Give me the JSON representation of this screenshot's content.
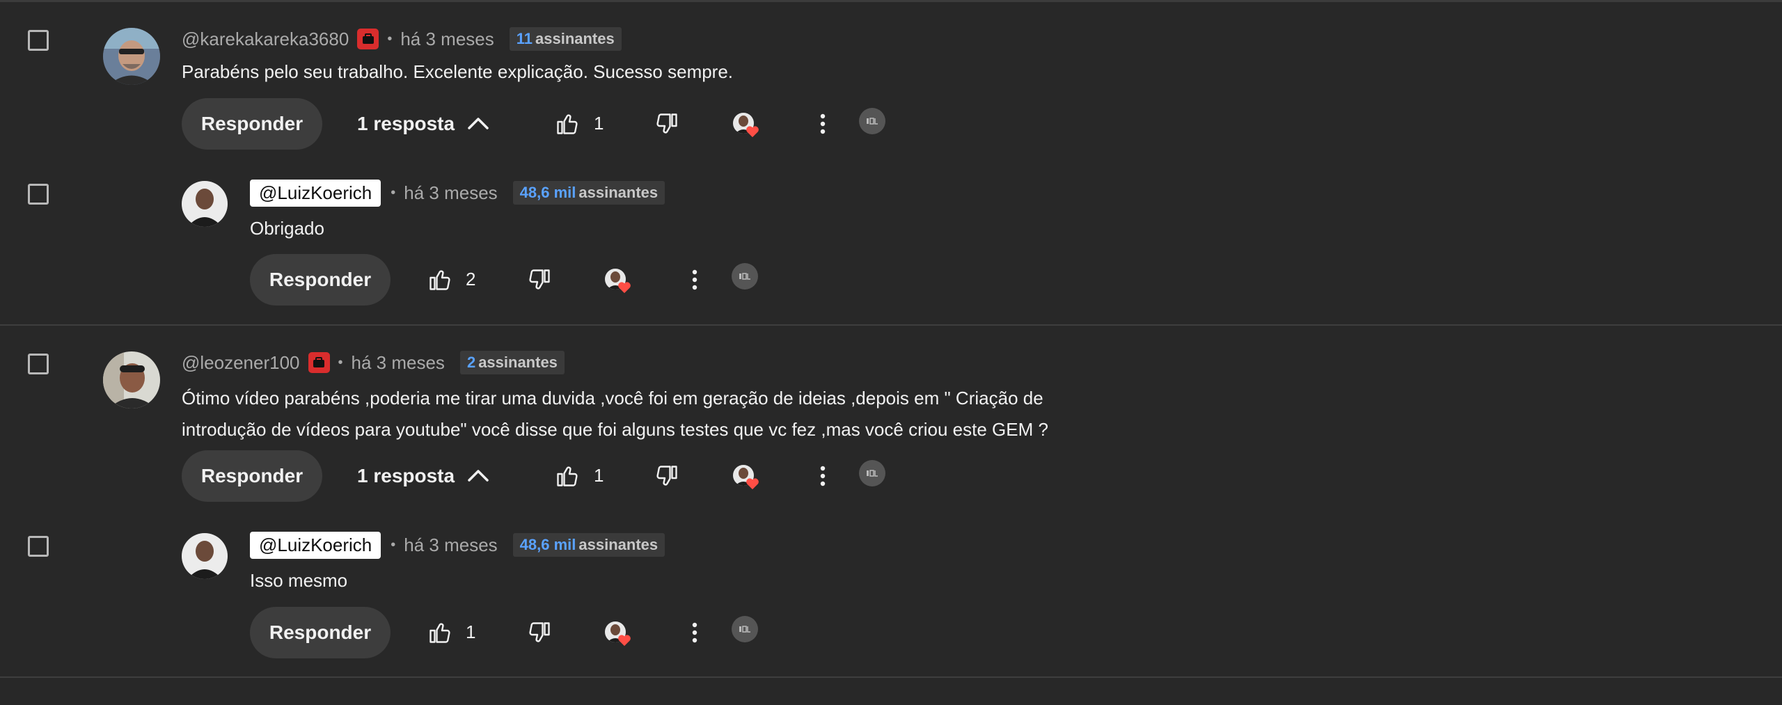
{
  "comments": [
    {
      "handle": "@karekakareka3680",
      "time": "há 3 meses",
      "subs_count": "11",
      "subs_label": "assinantes",
      "text_lines": [
        "Parabéns pelo seu trabalho. Excelente explicação. Sucesso sempre."
      ],
      "reply_label": "Responder",
      "replies_label": "1 resposta",
      "likes": "1",
      "reply": {
        "handle": "@LuizKoerich",
        "time": "há 3 meses",
        "subs_count": "48,6 mil",
        "subs_label": "assinantes",
        "text_lines": [
          "Obrigado"
        ],
        "reply_label": "Responder",
        "likes": "2"
      }
    },
    {
      "handle": "@leozener100",
      "time": "há 3 meses",
      "subs_count": "2",
      "subs_label": "assinantes",
      "text_lines": [
        "Ótimo vídeo parabéns ,poderia me tirar uma duvida ,você foi em geração de ideias ,depois em \" Criação de",
        "introdução de vídeos para youtube\" você disse que foi alguns testes que vc fez ,mas você criou este  GEM ?"
      ],
      "reply_label": "Responder",
      "replies_label": "1 resposta",
      "likes": "1",
      "reply": {
        "handle": "@LuizKoerich",
        "time": "há 3 meses",
        "subs_count": "48,6 mil",
        "subs_label": "assinantes",
        "text_lines": [
          "Isso mesmo"
        ],
        "reply_label": "Responder",
        "likes": "1"
      }
    }
  ],
  "icons": {
    "like": "thumbs-up-icon",
    "dislike": "thumbs-down-icon",
    "creator_heart": "heart-icon",
    "more": "more-vert-icon",
    "extension": "extension-icon",
    "channel_badge": "youtube-member-icon",
    "collapse": "chevron-up-icon"
  },
  "colors": {
    "background": "#282828",
    "subs_number": "#5aa2ff",
    "heart": "#ff4e45",
    "badge": "#d92d2d"
  }
}
